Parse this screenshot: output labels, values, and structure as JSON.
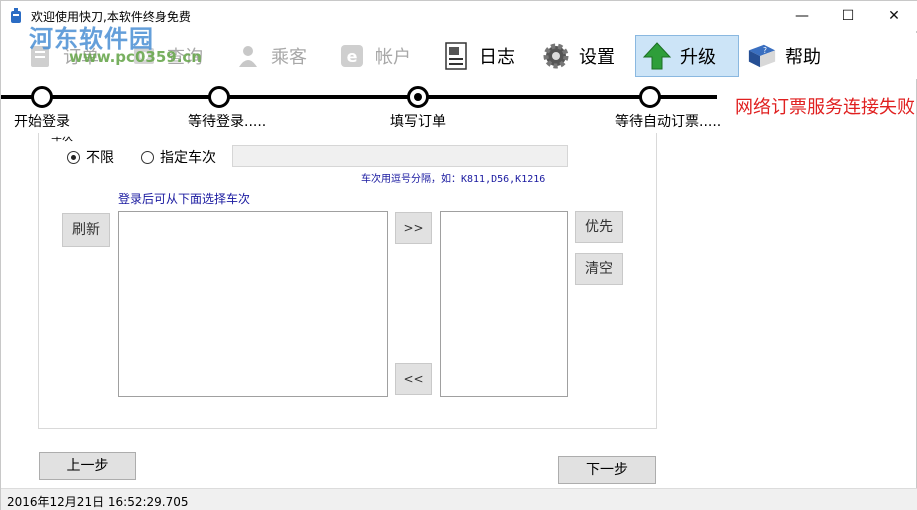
{
  "window": {
    "title": "欢迎使用快刀,本软件终身免费",
    "minimize": "—",
    "maximize": "☐",
    "close": "✕"
  },
  "watermark": {
    "logo_text": "河东软件园",
    "url_text": "www.pc0359.cn"
  },
  "toolbar": {
    "items": [
      {
        "label": "订单",
        "icon": "order-icon",
        "enabled": false
      },
      {
        "label": "查询",
        "icon": "query-icon",
        "enabled": false
      },
      {
        "label": "乘客",
        "icon": "passenger-icon",
        "enabled": false
      },
      {
        "label": "帐户",
        "icon": "account-icon",
        "enabled": false
      },
      {
        "label": "日志",
        "icon": "log-icon",
        "enabled": true
      },
      {
        "label": "设置",
        "icon": "gear-icon",
        "enabled": true
      },
      {
        "label": "升级",
        "icon": "upgrade-arrow-icon",
        "enabled": true,
        "active": true
      },
      {
        "label": "帮助",
        "icon": "help-book-icon",
        "enabled": true
      }
    ]
  },
  "steps": {
    "items": [
      {
        "label": "开始登录"
      },
      {
        "label": "等待登录....."
      },
      {
        "label": "填写订单",
        "current": true
      },
      {
        "label": "等待自动订票....."
      }
    ],
    "status_message": "网络订票服务连接失败"
  },
  "form": {
    "group_title": "车次",
    "radio_any": "不限",
    "radio_specific": "指定车次",
    "train_input_value": "",
    "train_hint": "车次用逗号分隔，如：K811,D56,K1216",
    "list_hint": "登录后可从下面选择车次",
    "refresh_button": "刷新",
    "add_button": ">>",
    "remove_button": "<<",
    "priority_button": "优先",
    "clear_button": "清空",
    "available_trains": [],
    "selected_trains": []
  },
  "nav": {
    "prev_button": "上一步",
    "next_button": "下一步"
  },
  "status": {
    "datetime": "2016年12月21日 16:52:29.705"
  },
  "colors": {
    "error_red": "#e02020",
    "hint_blue": "#1a1aa0",
    "active_tab_bg": "#cce4f7"
  }
}
